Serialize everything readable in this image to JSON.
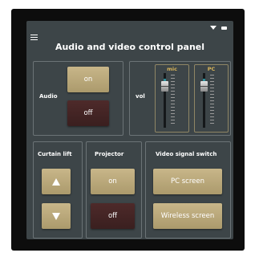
{
  "title": "Audio and video control panel",
  "audio": {
    "label": "Audio",
    "on": "on",
    "off": "off"
  },
  "volume": {
    "label": "vol",
    "channels": [
      {
        "name": "mic"
      },
      {
        "name": "PC"
      }
    ]
  },
  "curtain": {
    "label": "Curtain lift"
  },
  "projector": {
    "label": "Projector",
    "on": "on",
    "off": "off"
  },
  "video": {
    "label": "Video signal switch",
    "pc": "PC screen",
    "wireless": "Wireless screen"
  },
  "colors": {
    "background": "#3d4548",
    "gold_button": "#bda97b",
    "dark_button": "#452525",
    "fader_label": "#d9b55a"
  },
  "icons": {
    "menu": "hamburger-icon",
    "wifi": "wifi-icon",
    "battery": "battery-icon",
    "up": "arrow-up-icon",
    "down": "arrow-down-icon"
  }
}
